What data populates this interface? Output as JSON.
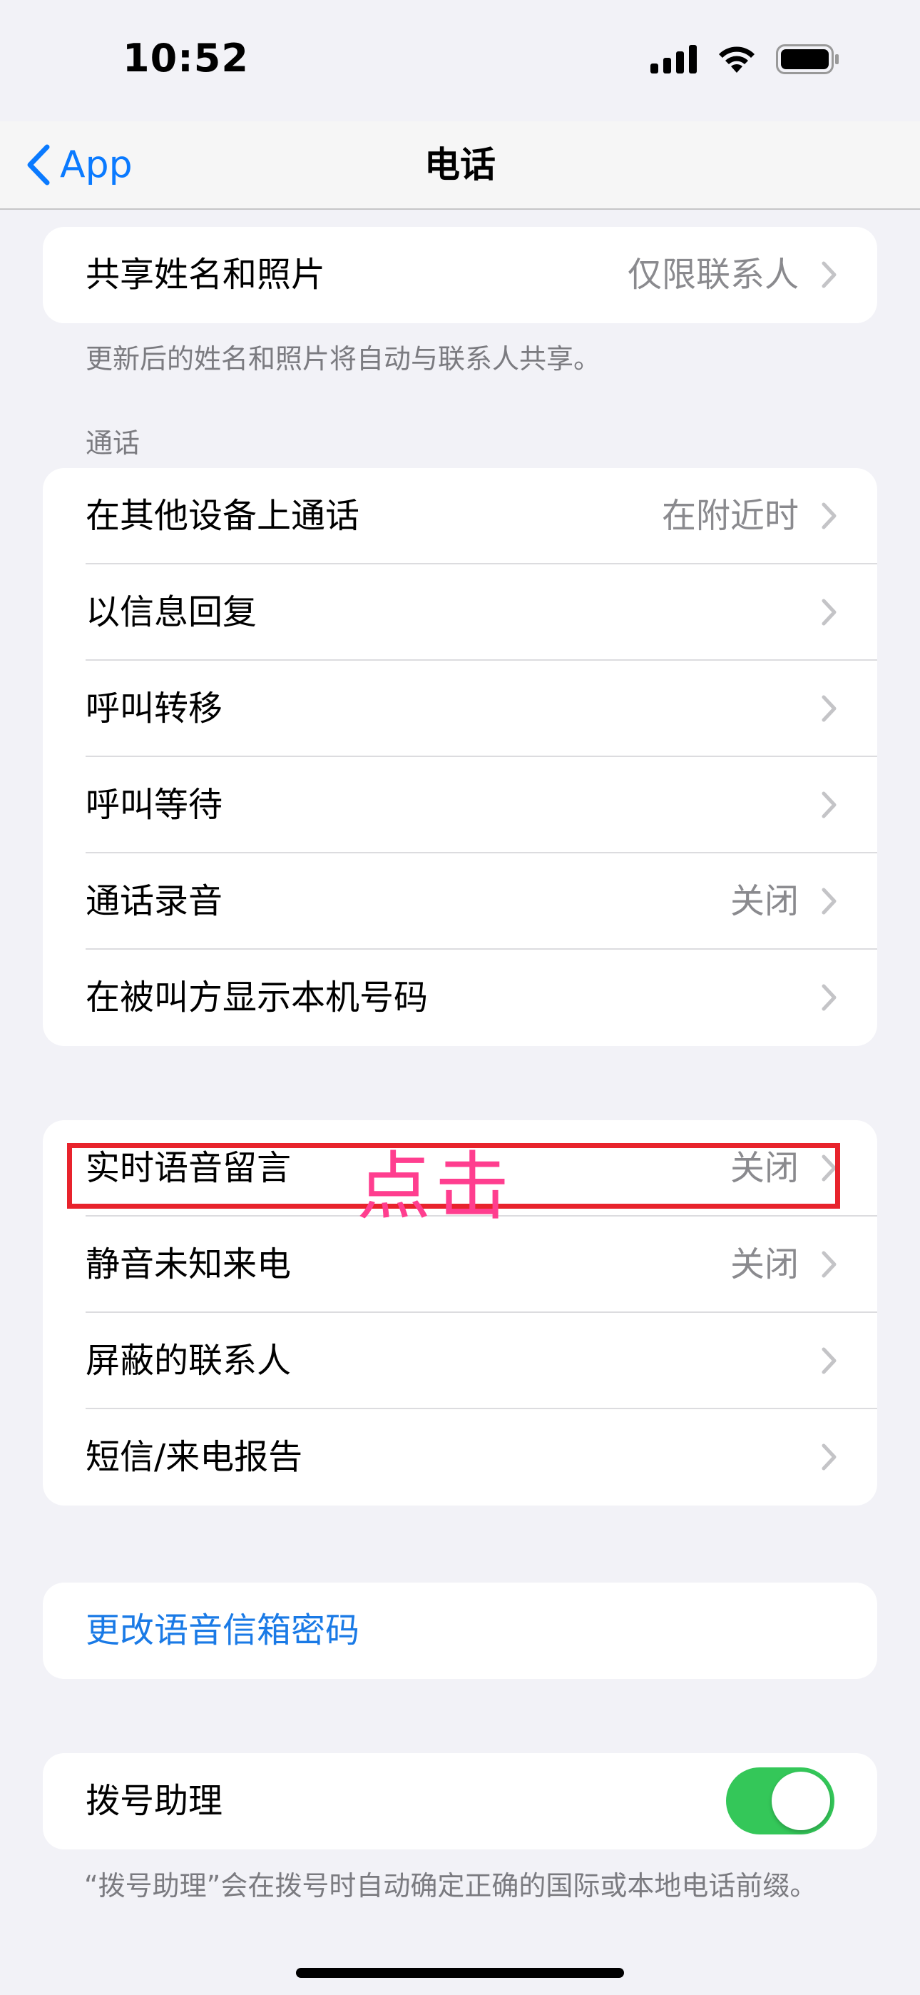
{
  "status_bar": {
    "time": "10:52"
  },
  "nav": {
    "back_label": "App",
    "title": "电话"
  },
  "share": {
    "label": "共享姓名和照片",
    "value": "仅限联系人",
    "footnote": "更新后的姓名和照片将自动与联系人共享。"
  },
  "calls_section": {
    "header": "通话",
    "items": [
      {
        "label": "在其他设备上通话",
        "value": "在附近时"
      },
      {
        "label": "以信息回复",
        "value": ""
      },
      {
        "label": "呼叫转移",
        "value": ""
      },
      {
        "label": "呼叫等待",
        "value": ""
      },
      {
        "label": "通话录音",
        "value": "关闭"
      },
      {
        "label": "在被叫方显示本机号码",
        "value": ""
      }
    ]
  },
  "voicemail_section": {
    "items": [
      {
        "label": "实时语音留言",
        "value": "关闭"
      },
      {
        "label": "静音未知来电",
        "value": "关闭"
      },
      {
        "label": "屏蔽的联系人",
        "value": ""
      },
      {
        "label": "短信/来电报告",
        "value": ""
      }
    ]
  },
  "change_password": {
    "label": "更改语音信箱密码"
  },
  "dial_assist": {
    "label": "拨号助理",
    "enabled": true,
    "footnote": "“拨号助理”会在拨号时自动确定正确的国际或本地电话前缀。"
  },
  "annotation": {
    "text": "点击",
    "color": "#ff3e8f",
    "box_color": "#e8232c"
  },
  "colors": {
    "accent": "#0a7aff",
    "toggle_on": "#34c759",
    "background": "#f2f2f7"
  }
}
